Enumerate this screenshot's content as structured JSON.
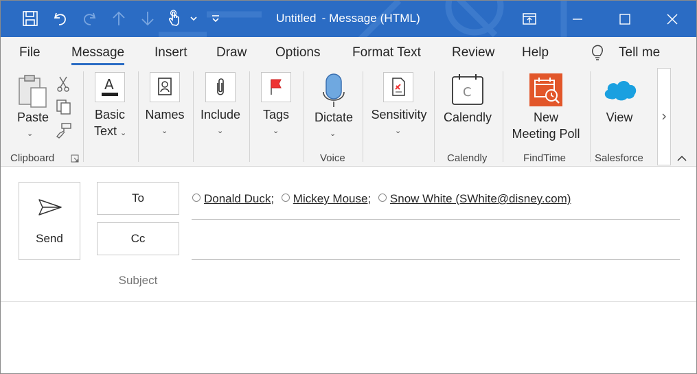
{
  "window": {
    "title": "Untitled",
    "title_suffix": "-  Message (HTML)",
    "quick_access": [
      "save-icon",
      "undo-icon",
      "redo-icon",
      "up-arrow-icon",
      "down-arrow-icon",
      "touch-mode-icon",
      "customize-icon"
    ],
    "controls": [
      "ribbon-display-icon",
      "minimize-icon",
      "maximize-icon",
      "close-icon"
    ],
    "accent": "#2b6cc4"
  },
  "menu": {
    "tabs": [
      {
        "label": "File"
      },
      {
        "label": "Message",
        "active": true
      },
      {
        "label": "Insert"
      },
      {
        "label": "Draw"
      },
      {
        "label": "Options"
      },
      {
        "label": "Format Text"
      },
      {
        "label": "Review"
      },
      {
        "label": "Help"
      }
    ],
    "tell_me": "Tell me"
  },
  "ribbon": {
    "paste": "Paste",
    "basic_text_1": "Basic",
    "basic_text_2": "Text",
    "names": "Names",
    "include": "Include",
    "tags": "Tags",
    "dictate": "Dictate",
    "sensitivity": "Sensitivity",
    "calendly": "Calendly",
    "new_meeting_1": "New",
    "new_meeting_2": "Meeting Poll",
    "view": "View",
    "groups": {
      "clipboard": "Clipboard",
      "voice": "Voice",
      "calendly": "Calendly",
      "findtime": "FindTime",
      "salesforce": "Salesforce"
    }
  },
  "compose": {
    "send": "Send",
    "to": "To",
    "cc": "Cc",
    "subject": "Subject",
    "recipients": [
      {
        "name": "Donald Duck",
        "sep": ";"
      },
      {
        "name": "Mickey Mouse",
        "sep": ";"
      },
      {
        "name": "Snow White (SWhite@disney.com)",
        "sep": ""
      }
    ]
  }
}
